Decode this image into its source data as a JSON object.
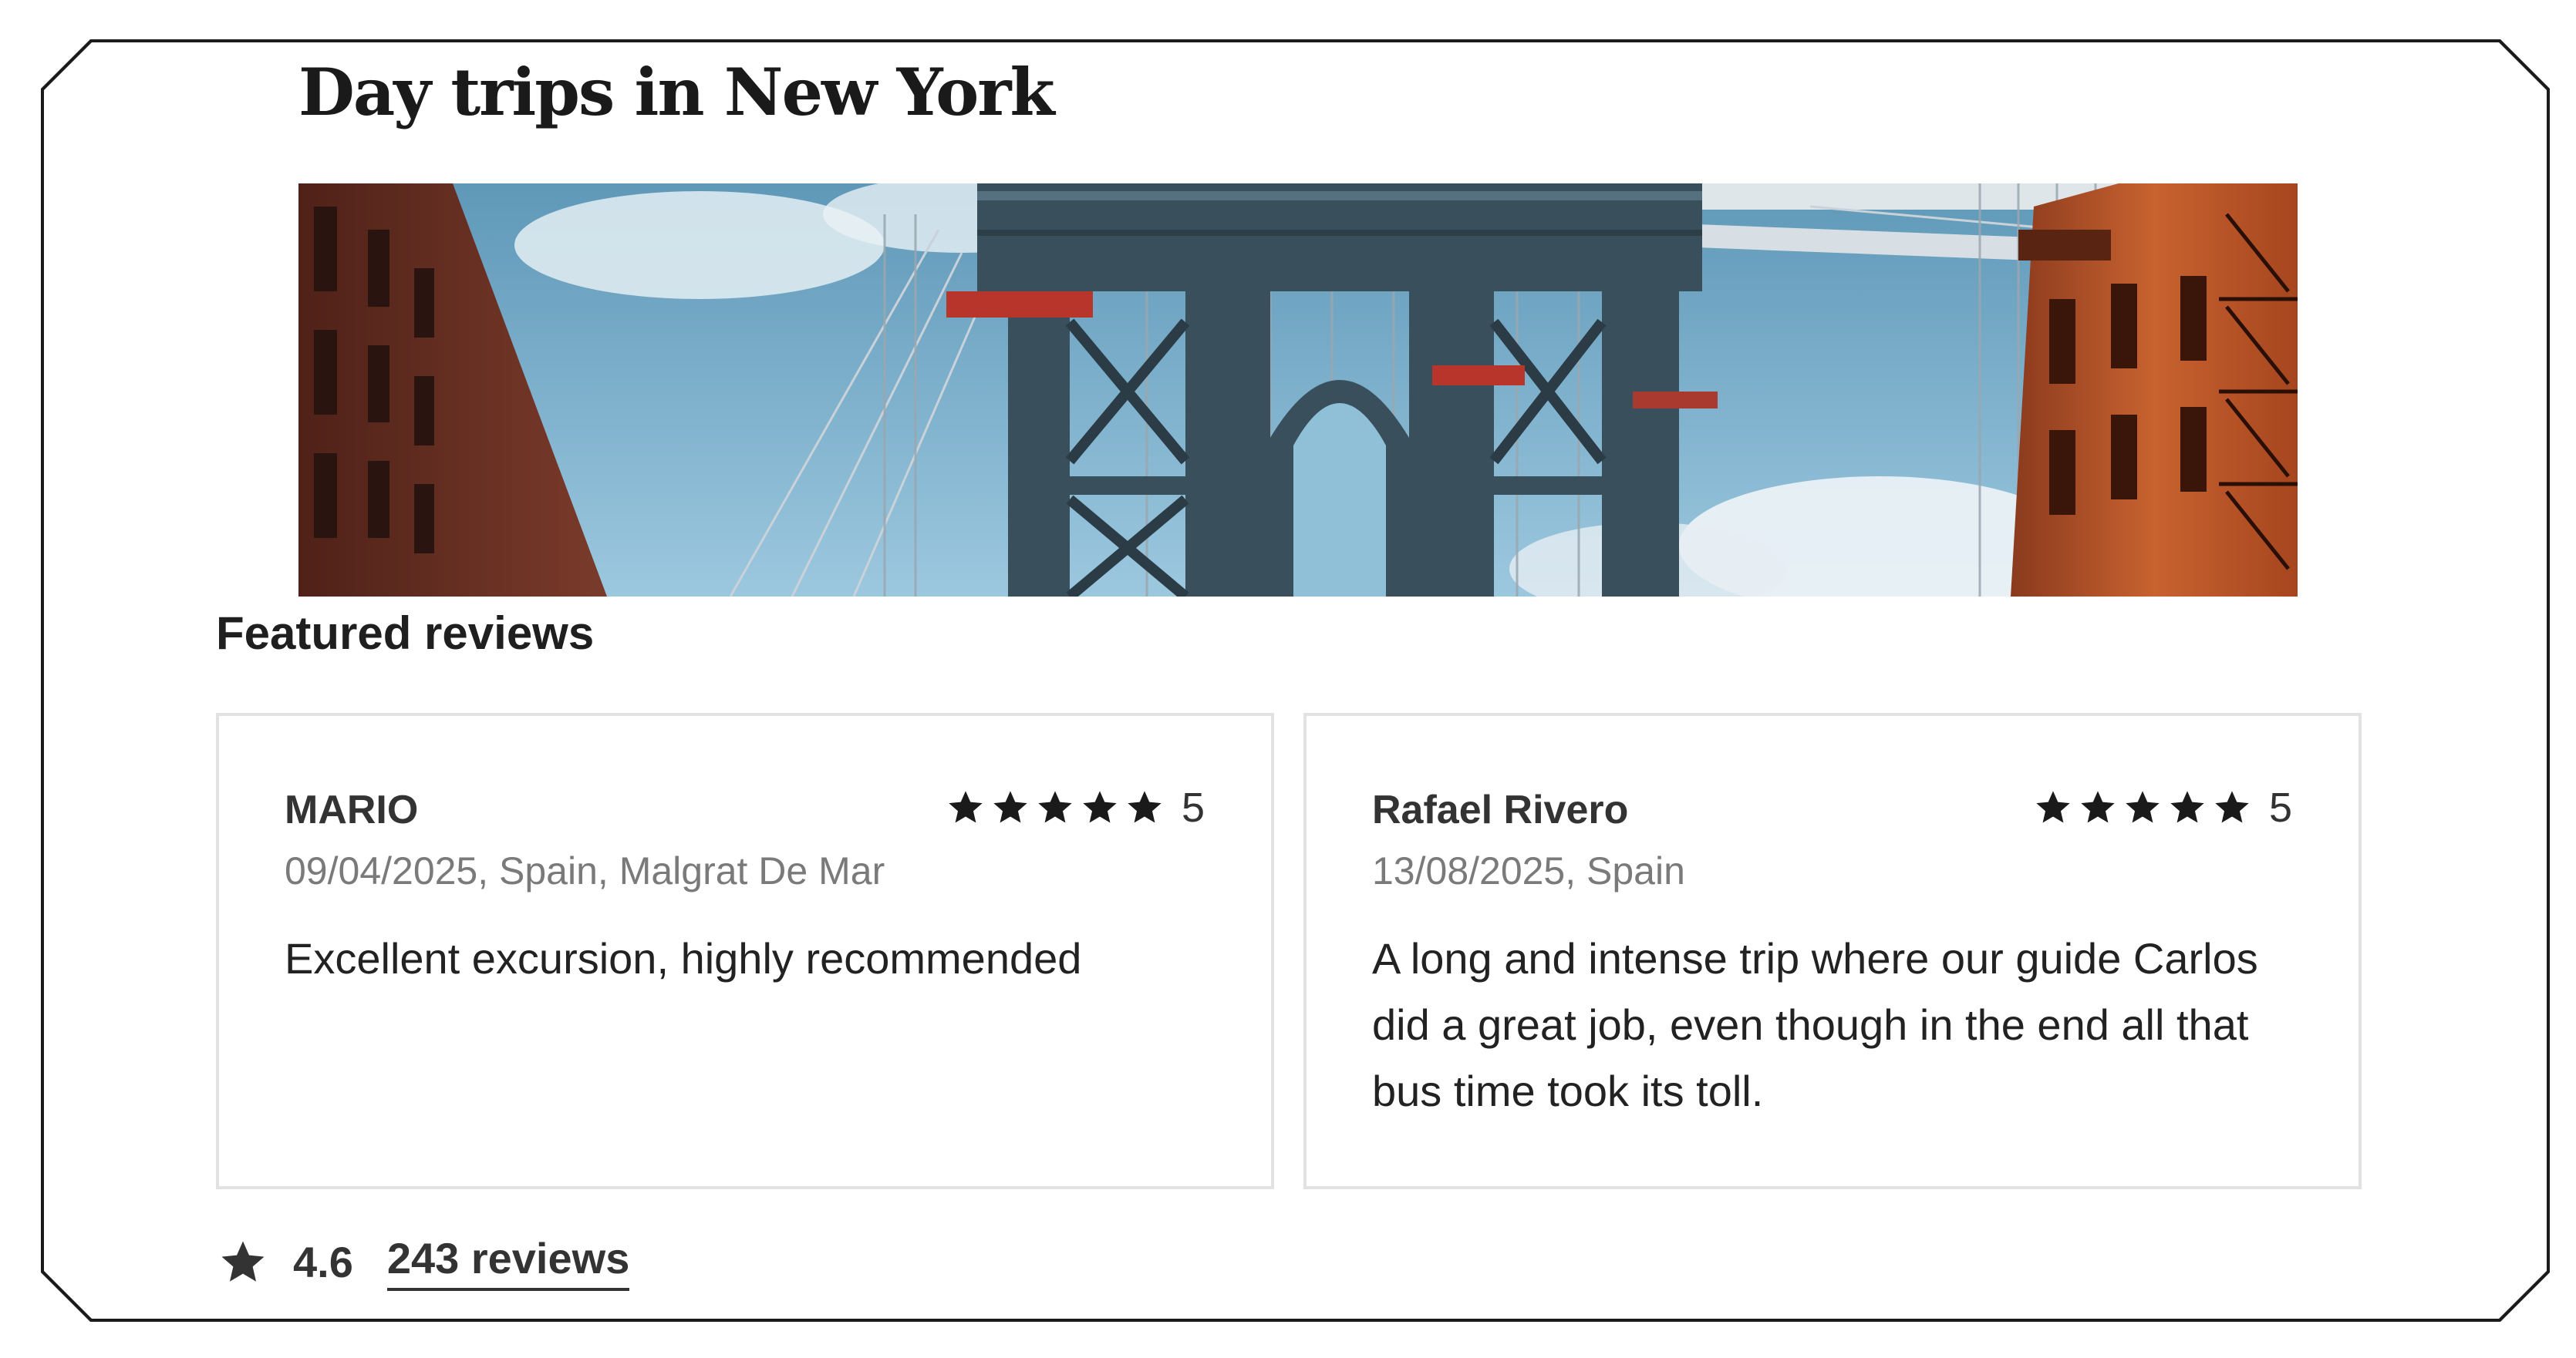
{
  "page": {
    "title": "Day trips in New York",
    "hero_image_alt": "Manhattan Bridge between brick buildings"
  },
  "reviews_section": {
    "title": "Featured reviews",
    "reviews": [
      {
        "name": "MARIO",
        "stars": 5,
        "rating": "5",
        "meta": "09/04/2025, Spain, Malgrat De Mar",
        "text": "Excellent excursion, highly recommended"
      },
      {
        "name": "Rafael Rivero",
        "stars": 5,
        "rating": "5",
        "meta": "13/08/2025, Spain",
        "text": "A long and intense trip where our guide Carlos did a great job, even though in the end all that bus time took its toll."
      }
    ]
  },
  "summary": {
    "icon": "star-icon",
    "rating": "4.6",
    "reviews_link": "243 reviews"
  },
  "colors": {
    "text": "#222222",
    "muted": "#7a7a7a",
    "card_border": "#e2e2e2",
    "sky": "#7fb0cc",
    "bridge": "#3a4f5c",
    "brick_left": "#6e3526",
    "brick_right": "#b8552c"
  }
}
